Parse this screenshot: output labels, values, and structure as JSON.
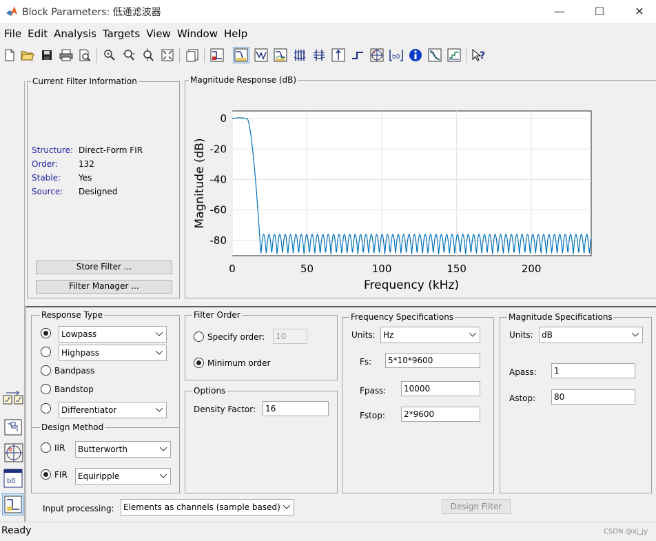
{
  "window": {
    "title": "Block Parameters: 低通滤波器",
    "minimize": "—",
    "maximize": "☐",
    "close": "✕"
  },
  "menu": [
    "File",
    "Edit",
    "Analysis",
    "Targets",
    "View",
    "Window",
    "Help"
  ],
  "toolbar_icons": [
    "new-icon",
    "open-icon",
    "save-icon",
    "print-icon",
    "print-preview-icon",
    "zoom-in-icon",
    "zoom-x-icon",
    "zoom-y-icon",
    "full-view-icon",
    "new-figure-icon",
    "filter-specs-icon",
    "magnitude-response-icon",
    "phase-response-icon",
    "magnitude-phase-icon",
    "group-delay-icon",
    "phase-delay-icon",
    "impulse-response-icon",
    "step-response-icon",
    "pole-zero-icon",
    "coefficients-icon",
    "filter-info-icon",
    "magnitude-estimate-icon",
    "round-off-noise-icon",
    "whats-this-icon"
  ],
  "filter_info": {
    "title": "Current Filter Information",
    "rows": [
      {
        "key": "Structure:",
        "value": "Direct-Form FIR"
      },
      {
        "key": "Order:",
        "value": "132"
      },
      {
        "key": "Stable:",
        "value": "Yes"
      },
      {
        "key": "Source:",
        "value": "Designed"
      }
    ],
    "store_button": "Store Filter ...",
    "manager_button": "Filter Manager ..."
  },
  "plot": {
    "title": "Magnitude Response (dB)",
    "xlabel": "Frequency (kHz)",
    "ylabel": "Magnitude (dB)",
    "xticks": [
      "0",
      "50",
      "100",
      "150",
      "200"
    ],
    "yticks": [
      "0",
      "-20",
      "-40",
      "-60",
      "-80"
    ]
  },
  "chart_data": {
    "type": "line",
    "title": "",
    "xlabel": "Frequency (kHz)",
    "ylabel": "Magnitude (dB)",
    "xlim": [
      0,
      240
    ],
    "ylim": [
      -90,
      5
    ],
    "grid": true,
    "series": [
      {
        "passband_edge_khz": 10,
        "stopband_edge_khz": 19.2,
        "passband_level_db": 0,
        "stopband_level_db": -80,
        "color": "#0072bd"
      }
    ]
  },
  "response_type": {
    "title": "Response Type",
    "options": [
      {
        "label": "Lowpass",
        "selected": true
      },
      {
        "label": "Highpass",
        "selected": false
      },
      {
        "label": "Bandpass",
        "selected": false
      },
      {
        "label": "Bandstop",
        "selected": false
      },
      {
        "label": "Differentiator",
        "selected": false
      }
    ]
  },
  "design_method": {
    "title": "Design Method",
    "iir_label": "IIR",
    "iir_value": "Butterworth",
    "fir_label": "FIR",
    "fir_value": "Equiripple",
    "fir_selected": true
  },
  "filter_order": {
    "title": "Filter Order",
    "specify_label": "Specify order:",
    "specify_value": "10",
    "minimum_label": "Minimum order"
  },
  "options": {
    "title": "Options",
    "density_label": "Density Factor:",
    "density_value": "16"
  },
  "freq_specs": {
    "title": "Frequency Specifications",
    "units_label": "Units:",
    "units_value": "Hz",
    "fs_label": "Fs:",
    "fs_value": "5*10*9600",
    "fpass_label": "Fpass:",
    "fpass_value": "10000",
    "fstop_label": "Fstop:",
    "fstop_value": "2*9600"
  },
  "mag_specs": {
    "title": "Magnitude Specifications",
    "units_label": "Units:",
    "units_value": "dB",
    "apass_label": "Apass:",
    "apass_value": "1",
    "astop_label": "Astop:",
    "astop_value": "80"
  },
  "input_processing": {
    "label": "Input processing:",
    "value": "Elements as channels (sample based)"
  },
  "design_button": "Design Filter",
  "status": {
    "text": "Ready",
    "watermark": "CSDN @xj_jy"
  }
}
